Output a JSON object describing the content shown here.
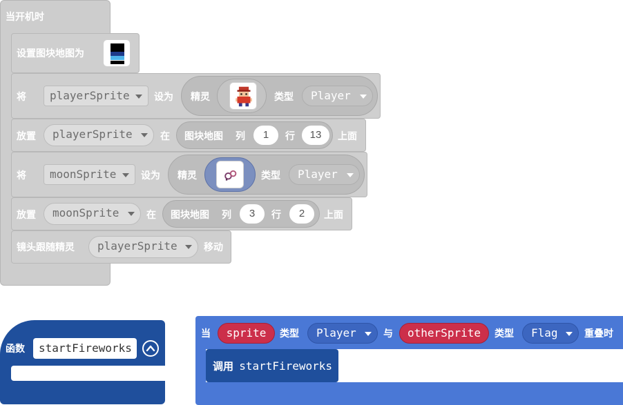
{
  "hat": {
    "label": "当开机时"
  },
  "blocks": {
    "set_tilemap": {
      "label": "设置图块地图为"
    },
    "set_player": {
      "verb": "将",
      "var": "playerSprite",
      "set_label": "设为",
      "sprite_label": "精灵",
      "kind_label": "类型",
      "kind": "Player"
    },
    "place_player": {
      "verb": "放置",
      "var": "playerSprite",
      "at_label": "在",
      "loc_label": "图块地图",
      "col_label": "列",
      "col": "1",
      "row_label": "行",
      "row": "13",
      "top_label": "上面"
    },
    "set_moon": {
      "verb": "将",
      "var": "moonSprite",
      "set_label": "设为",
      "sprite_label": "精灵",
      "kind_label": "类型",
      "kind": "Player"
    },
    "place_moon": {
      "verb": "放置",
      "var": "moonSprite",
      "at_label": "在",
      "loc_label": "图块地图",
      "col_label": "列",
      "col": "3",
      "row_label": "行",
      "row": "2",
      "top_label": "上面"
    },
    "camera": {
      "label": "镜头跟随精灵",
      "var": "playerSprite",
      "suffix": "移动"
    }
  },
  "function_block": {
    "label": "函数",
    "name": "startFireworks"
  },
  "overlap_event": {
    "on_label": "当",
    "sprite": "sprite",
    "kind_label1": "类型",
    "kind1": "Player",
    "with_label": "与",
    "other": "otherSprite",
    "kind_label2": "类型",
    "kind2": "Flag",
    "suffix": "重叠时",
    "call": {
      "label": "调用",
      "name": "startFireworks"
    }
  },
  "colors": {
    "grey_block": "#cfcfcf",
    "function_blue": "#1f4f9c",
    "event_blue": "#4a78d6",
    "sprite_red": "#cc2f4a"
  }
}
